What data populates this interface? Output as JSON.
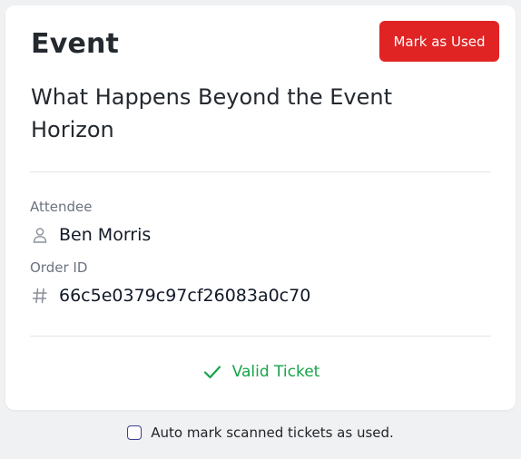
{
  "card": {
    "title": "Event",
    "mark_used_label": "Mark as Used",
    "event_name": "What Happens Beyond the Event Horizon",
    "attendee": {
      "label": "Attendee",
      "icon": "user-icon",
      "value": "Ben Morris"
    },
    "order": {
      "label": "Order ID",
      "icon": "hash-icon",
      "value": "66c5e0379c97cf26083a0c70"
    },
    "status": {
      "icon": "check-icon",
      "text": "Valid Ticket"
    }
  },
  "footer": {
    "auto_mark_label": "Auto mark scanned tickets as used.",
    "auto_mark_checked": false
  },
  "colors": {
    "danger": "#e02424",
    "success": "#16a34a",
    "background": "#f0f1f3"
  }
}
